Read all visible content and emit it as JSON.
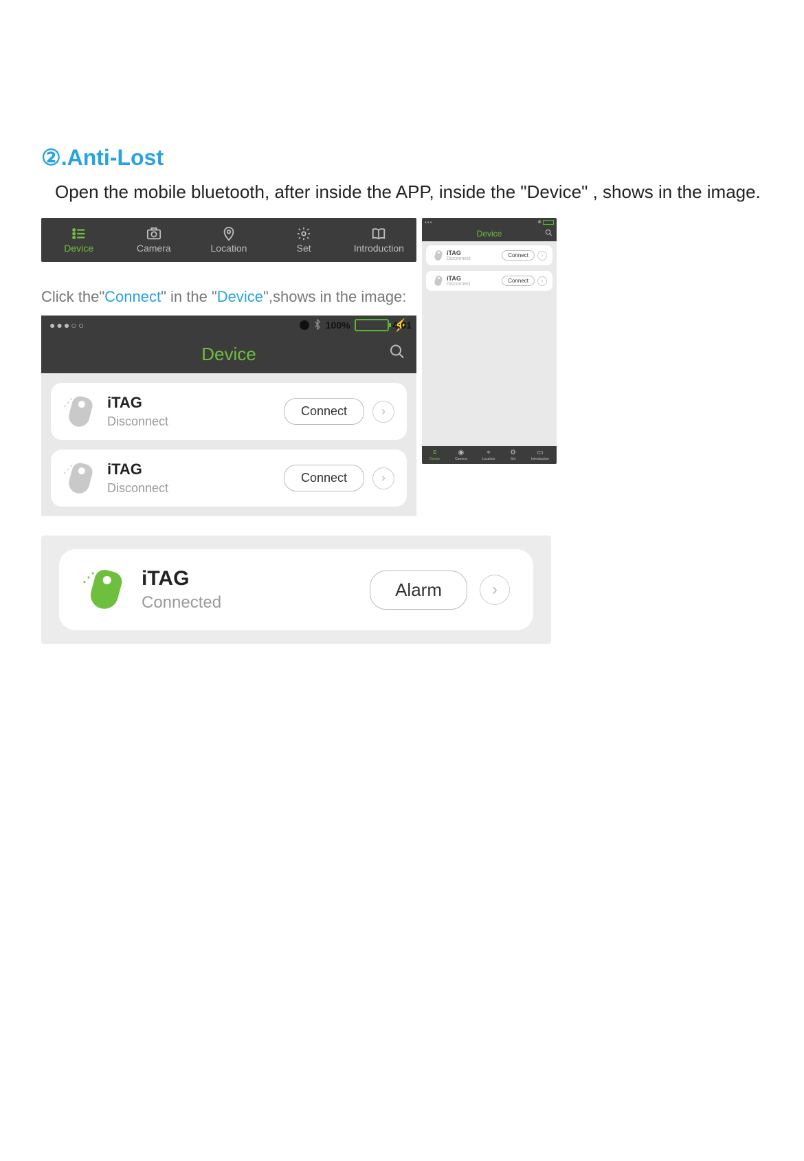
{
  "section": {
    "title": "②.Anti-Lost",
    "body": "Open the mobile bluetooth, after inside the APP, inside the  \"Device\"  , shows in the image."
  },
  "nav": {
    "items": [
      {
        "label": "Device",
        "active": true
      },
      {
        "label": "Camera",
        "active": false
      },
      {
        "label": "Location",
        "active": false
      },
      {
        "label": "Set",
        "active": false
      },
      {
        "label": "Introduction",
        "active": false
      }
    ]
  },
  "instruction": {
    "pre": "Click the\"",
    "connect": "Connect",
    "mid": "\" in the \"",
    "device": "Device",
    "post": "\",shows in the image:"
  },
  "app": {
    "status": {
      "signal_dots": "●●●○○",
      "time": "4:01",
      "battery_pct": "100%",
      "charging": "⚡"
    },
    "title": "Device",
    "rows": [
      {
        "name": "iTAG",
        "status": "Disconnect",
        "button": "Connect",
        "connected": false
      },
      {
        "name": "iTAG",
        "status": "Disconnect",
        "button": "Connect",
        "connected": false
      }
    ]
  },
  "mini": {
    "status_dots": "•••",
    "title": "Device",
    "rows": [
      {
        "name": "iTAG",
        "status": "Disconnect",
        "button": "Connect"
      },
      {
        "name": "iTAG",
        "status": "Disconnect",
        "button": "Connect"
      }
    ],
    "nav": [
      {
        "label": "Device",
        "active": true
      },
      {
        "label": "Camera",
        "active": false
      },
      {
        "label": "Location",
        "active": false
      },
      {
        "label": "Set",
        "active": false
      },
      {
        "label": "Introduction",
        "active": false
      }
    ]
  },
  "connected_row": {
    "name": "iTAG",
    "status": "Connected",
    "button": "Alarm"
  }
}
